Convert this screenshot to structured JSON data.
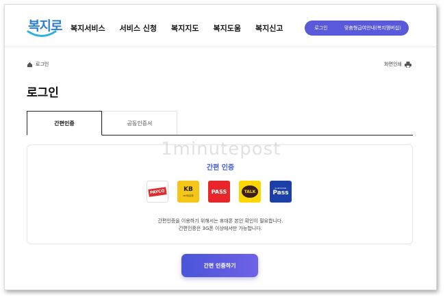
{
  "logo": {
    "text": "복지로"
  },
  "nav": {
    "items": [
      {
        "label": "복지서비스"
      },
      {
        "label": "서비스 신청"
      },
      {
        "label": "복지지도"
      },
      {
        "label": "복지도움"
      },
      {
        "label": "복지신고"
      }
    ]
  },
  "header": {
    "login_label": "로그인",
    "membership_label": "맞춤형급여안내(복지멤버십)",
    "accent_color": "#5a59d9"
  },
  "breadcrumb": {
    "home_label": "로그인"
  },
  "print": {
    "label": "화면인쇄"
  },
  "page": {
    "title": "로그인"
  },
  "tabs": [
    {
      "label": "간편인증",
      "active": true
    },
    {
      "label": "공동인증서",
      "active": false
    }
  ],
  "card": {
    "title": "간편 인증",
    "providers": [
      {
        "name": "PAYCO",
        "label": "PAYCO",
        "color": "#e02b2b"
      },
      {
        "name": "KB",
        "label": "KB",
        "sublabel": "KB국민은행",
        "color": "#f5c518"
      },
      {
        "name": "PASS",
        "label": "PASS",
        "color": "#e8262a"
      },
      {
        "name": "KakaoTalk",
        "label": "TALK",
        "color": "#ffd500"
      },
      {
        "name": "Samsung Pass",
        "label": "Pass",
        "sublabel": "SAMSUNG",
        "color": "#1c3fa8"
      }
    ],
    "notice_line1": "간편인증을 이용하기 위해서는 휴대폰 본인 확인이 필요합니다.",
    "notice_line2": "간편인증은 3G폰 이상에서만 가능합니다."
  },
  "submit": {
    "label": "간편 인증하기"
  },
  "watermark": {
    "text": "1minutepost"
  }
}
